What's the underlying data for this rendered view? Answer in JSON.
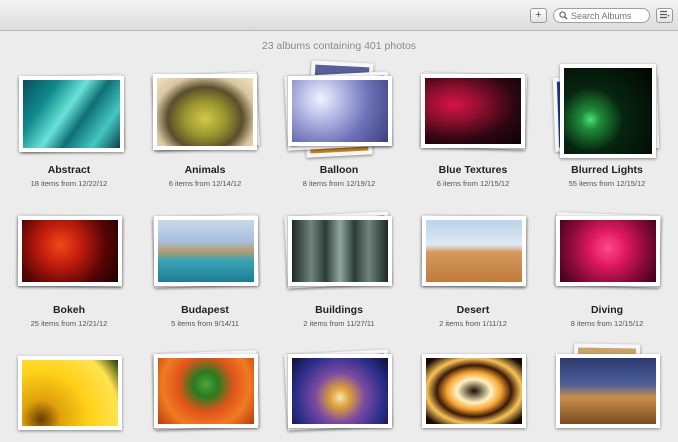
{
  "toolbar": {
    "add_label": "+",
    "search_placeholder": "Search Albums",
    "search_value": "",
    "menu_label": "≡"
  },
  "summary": "23 albums containing 401 photos",
  "albums": [
    {
      "title": "Abstract",
      "subtitle": "18 items from 12/22/12"
    },
    {
      "title": "Animals",
      "subtitle": "6 items from 12/14/12"
    },
    {
      "title": "Balloon",
      "subtitle": "8 items from 12/19/12"
    },
    {
      "title": "Blue Textures",
      "subtitle": "6 items from 12/15/12"
    },
    {
      "title": "Blurred Lights",
      "subtitle": "55 items from 12/15/12"
    },
    {
      "title": "Bokeh",
      "subtitle": "25 items from 12/21/12"
    },
    {
      "title": "Budapest",
      "subtitle": "5 items from 9/14/11"
    },
    {
      "title": "Buildings",
      "subtitle": "2 items from 11/27/11"
    },
    {
      "title": "Desert",
      "subtitle": "2 items from 1/11/12"
    },
    {
      "title": "Diving",
      "subtitle": "8 items from 12/15/12"
    },
    {
      "title": "",
      "subtitle": ""
    },
    {
      "title": "",
      "subtitle": ""
    },
    {
      "title": "",
      "subtitle": ""
    },
    {
      "title": "",
      "subtitle": ""
    },
    {
      "title": "",
      "subtitle": ""
    }
  ]
}
